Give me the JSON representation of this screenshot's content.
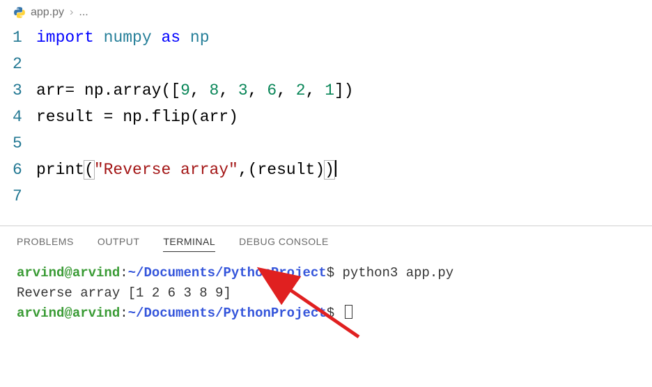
{
  "breadcrumb": {
    "filename": "app.py",
    "separator": "›",
    "trail": "..."
  },
  "editor": {
    "lines": [
      {
        "num": "1",
        "tokens": [
          {
            "t": "kw",
            "v": "import"
          },
          {
            "t": "sp",
            "v": " "
          },
          {
            "t": "id",
            "v": "numpy"
          },
          {
            "t": "sp",
            "v": " "
          },
          {
            "t": "kw",
            "v": "as"
          },
          {
            "t": "sp",
            "v": " "
          },
          {
            "t": "id",
            "v": "np"
          }
        ]
      },
      {
        "num": "2",
        "tokens": []
      },
      {
        "num": "3",
        "tokens": [
          {
            "t": "fn",
            "v": "arr"
          },
          {
            "t": "punc",
            "v": "= "
          },
          {
            "t": "fn",
            "v": "np"
          },
          {
            "t": "punc",
            "v": "."
          },
          {
            "t": "fn",
            "v": "array"
          },
          {
            "t": "punc",
            "v": "(["
          },
          {
            "t": "num",
            "v": "9"
          },
          {
            "t": "punc",
            "v": ", "
          },
          {
            "t": "num",
            "v": "8"
          },
          {
            "t": "punc",
            "v": ", "
          },
          {
            "t": "num",
            "v": "3"
          },
          {
            "t": "punc",
            "v": ", "
          },
          {
            "t": "num",
            "v": "6"
          },
          {
            "t": "punc",
            "v": ", "
          },
          {
            "t": "num",
            "v": "2"
          },
          {
            "t": "punc",
            "v": ", "
          },
          {
            "t": "num",
            "v": "1"
          },
          {
            "t": "punc",
            "v": "])"
          }
        ]
      },
      {
        "num": "4",
        "tokens": [
          {
            "t": "fn",
            "v": "result "
          },
          {
            "t": "punc",
            "v": "= "
          },
          {
            "t": "fn",
            "v": "np"
          },
          {
            "t": "punc",
            "v": "."
          },
          {
            "t": "fn",
            "v": "flip"
          },
          {
            "t": "punc",
            "v": "("
          },
          {
            "t": "fn",
            "v": "arr"
          },
          {
            "t": "punc",
            "v": ")"
          }
        ]
      },
      {
        "num": "5",
        "tokens": []
      },
      {
        "num": "6",
        "tokens": [
          {
            "t": "fn",
            "v": "print"
          },
          {
            "t": "punc hl",
            "v": "("
          },
          {
            "t": "str",
            "v": "\"Reverse array\""
          },
          {
            "t": "punc",
            "v": ","
          },
          {
            "t": "punc",
            "v": "("
          },
          {
            "t": "fn",
            "v": "result"
          },
          {
            "t": "punc",
            "v": ")"
          },
          {
            "t": "punc hl",
            "v": ")"
          },
          {
            "t": "cursor",
            "v": ""
          }
        ]
      },
      {
        "num": "7",
        "tokens": []
      }
    ]
  },
  "panel": {
    "tabs": [
      "PROBLEMS",
      "OUTPUT",
      "TERMINAL",
      "DEBUG CONSOLE"
    ],
    "active_tab": "TERMINAL"
  },
  "terminal": {
    "lines": [
      {
        "parts": [
          {
            "c": "t-user",
            "v": "arvind@arvind"
          },
          {
            "c": "t-text",
            "v": ":"
          },
          {
            "c": "t-path",
            "v": "~/Documents/PythonProject"
          },
          {
            "c": "t-text",
            "v": "$ python3 app.py"
          }
        ]
      },
      {
        "parts": [
          {
            "c": "t-text",
            "v": "Reverse array [1 2 6 3 8 9]"
          }
        ]
      },
      {
        "parts": [
          {
            "c": "t-user",
            "v": "arvind@arvind"
          },
          {
            "c": "t-text",
            "v": ":"
          },
          {
            "c": "t-path",
            "v": "~/Documents/PythonProject"
          },
          {
            "c": "t-text",
            "v": "$ "
          },
          {
            "c": "cursorbox",
            "v": ""
          }
        ]
      }
    ]
  }
}
